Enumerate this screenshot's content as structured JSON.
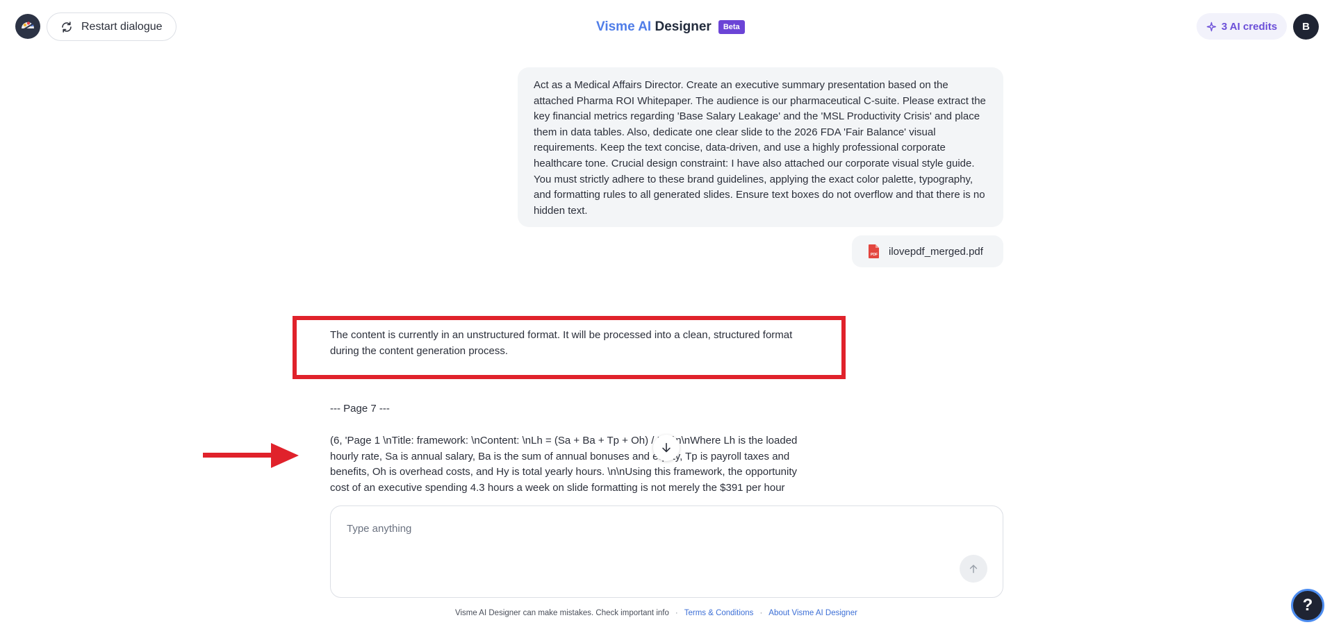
{
  "header": {
    "restart_label": "Restart dialogue",
    "brand_visme": "Visme AI",
    "brand_designer": "Designer",
    "beta_badge": "Beta",
    "credits_label": "3 AI credits",
    "avatar_initial": "B"
  },
  "chat": {
    "user_message": "Act as a Medical Affairs Director. Create an executive summary presentation based on the attached Pharma ROI Whitepaper. The audience is our pharmaceutical C-suite. Please extract the key financial metrics regarding 'Base Salary Leakage' and the 'MSL Productivity Crisis' and place them in data tables. Also, dedicate one clear slide to the 2026 FDA 'Fair Balance' visual requirements. Keep the text concise, data-driven, and use a highly professional corporate healthcare tone. Crucial design constraint: I have also attached our corporate visual style guide. You must strictly adhere to these brand guidelines, applying the exact color palette, typography, and formatting rules to all generated slides. Ensure text boxes do not overflow and that there is no hidden text.",
    "attachment_name": "ilovepdf_merged.pdf",
    "ai_notice": "The content is currently in an unstructured format. It will be processed into a clean, structured format during the content generation process.",
    "page_marker": "--- Page 7 ---",
    "ai_content": "(6, 'Page 1 \\nTitle: framework: \\nContent: \\nLh = (Sa + Ba + Tp + Oh) / Hy \\n\\nWhere Lh is the loaded hourly rate, Sa is annual salary, Ba is the sum of annual bonuses and equity, Tp is payroll taxes and benefits, Oh is overhead costs, and Hy is total yearly hours. \\n\\nUsing this framework, the opportunity cost of an executive spending 4.3 hours a week on slide formatting is not merely the $391 per hour"
  },
  "composer": {
    "placeholder": "Type anything"
  },
  "footer": {
    "disclaimer": "Visme AI Designer can make mistakes. Check important info",
    "terms_link": "Terms & Conditions",
    "about_link": "About Visme AI Designer",
    "separator": "·"
  },
  "help": {
    "label": "?"
  },
  "colors": {
    "accent_purple": "#6b44d6",
    "brand_blue": "#4f7de8",
    "annotation_red": "#e0222b",
    "link_blue": "#3c6fd6"
  }
}
